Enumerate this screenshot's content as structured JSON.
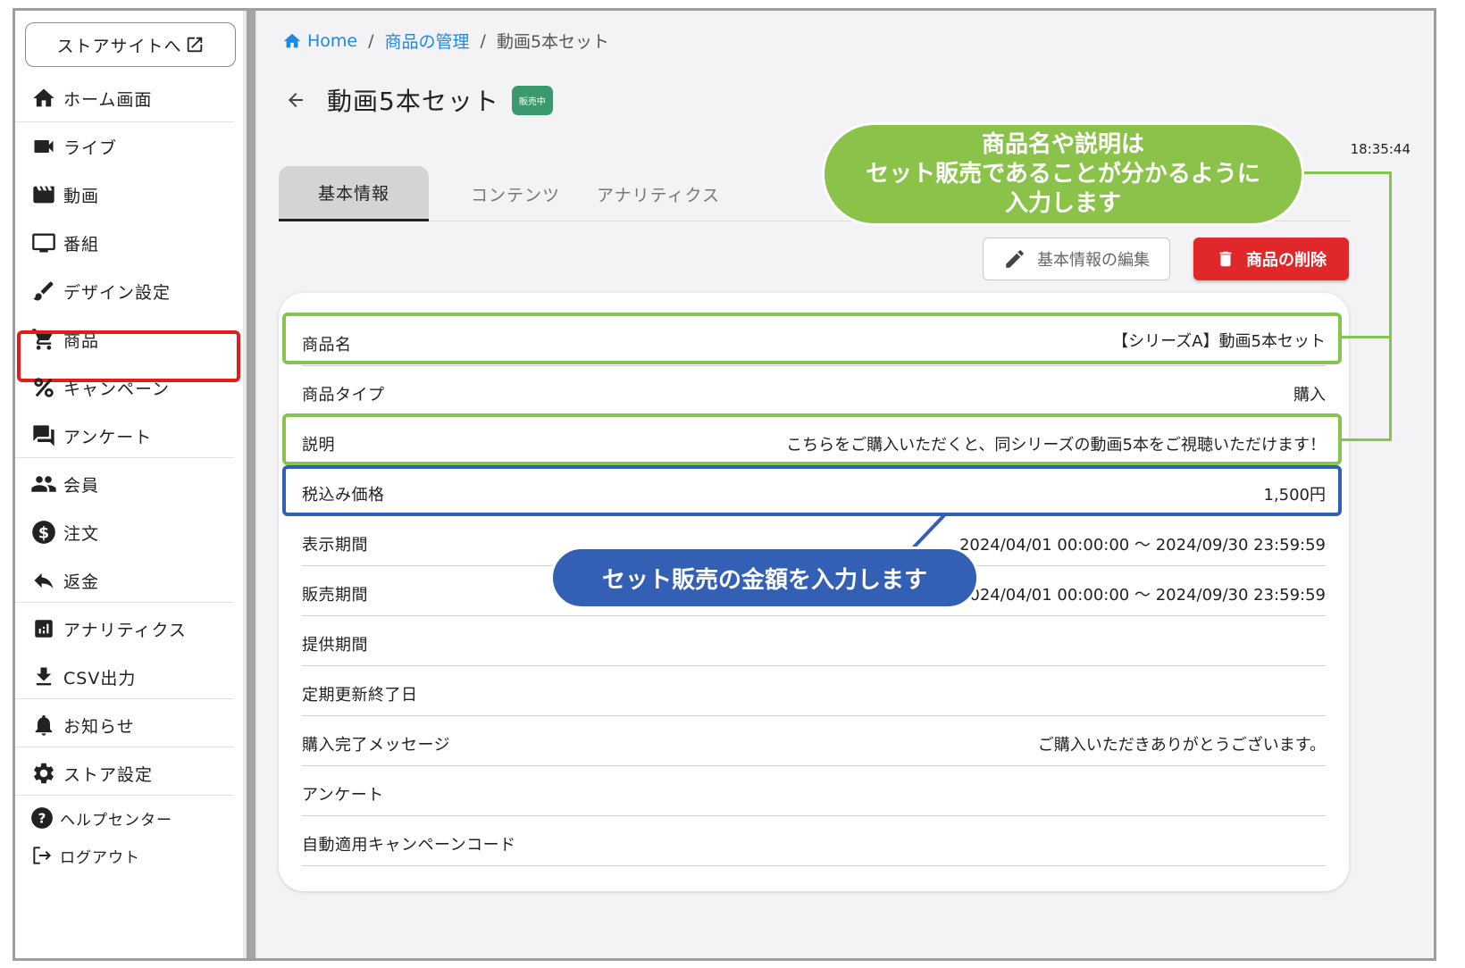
{
  "sidebar": {
    "store_link": "ストアサイトへ",
    "items": [
      {
        "label": "ホーム画面",
        "icon": "home-icon"
      },
      {
        "label": "ライブ",
        "icon": "videocam-icon"
      },
      {
        "label": "動画",
        "icon": "movie-icon"
      },
      {
        "label": "番組",
        "icon": "tv-icon"
      },
      {
        "label": "デザイン設定",
        "icon": "brush-icon"
      },
      {
        "label": "商品",
        "icon": "cart-icon"
      },
      {
        "label": "キャンペーン",
        "icon": "percent-icon"
      },
      {
        "label": "アンケート",
        "icon": "forum-icon"
      },
      {
        "label": "会員",
        "icon": "people-icon"
      },
      {
        "label": "注文",
        "icon": "dollar-icon"
      },
      {
        "label": "返金",
        "icon": "reply-icon"
      },
      {
        "label": "アナリティクス",
        "icon": "analytics-icon"
      },
      {
        "label": "CSV出力",
        "icon": "download-icon"
      },
      {
        "label": "お知らせ",
        "icon": "bell-icon"
      },
      {
        "label": "ストア設定",
        "icon": "gear-icon"
      }
    ],
    "help": "ヘルプセンター",
    "logout": "ログアウト"
  },
  "breadcrumb": {
    "home": "Home",
    "manage": "商品の管理",
    "current": "動画5本セット"
  },
  "title": "動画5本セット",
  "badge": "販売中",
  "time": "18:35:44",
  "tabs": [
    "基本情報",
    "コンテンツ",
    "アナリティクス"
  ],
  "actions": {
    "edit": "基本情報の編集",
    "delete": "商品の削除"
  },
  "details": [
    {
      "key": "商品名",
      "value": "【シリーズA】動画5本セット"
    },
    {
      "key": "商品タイプ",
      "value": "購入"
    },
    {
      "key": "説明",
      "value": "こちらをご購入いただくと、同シリーズの動画5本をご視聴いただけます！"
    },
    {
      "key": "税込み価格",
      "value": "1,500円"
    },
    {
      "key": "表示期間",
      "value": "2024/04/01 00:00:00 〜 2024/09/30 23:59:59"
    },
    {
      "key": "販売期間",
      "value": "2024/04/01 00:00:00 〜 2024/09/30 23:59:59"
    },
    {
      "key": "提供期間",
      "value": ""
    },
    {
      "key": "定期更新終了日",
      "value": ""
    },
    {
      "key": "購入完了メッセージ",
      "value": "ご購入いただきありがとうございます。"
    },
    {
      "key": "アンケート",
      "value": ""
    },
    {
      "key": "自動適用キャンペーンコード",
      "value": ""
    }
  ],
  "callouts": {
    "green": [
      "商品名や説明は",
      "セット販売であることが分かるように",
      "入力します"
    ],
    "blue": "セット販売の金額を入力します"
  },
  "colors": {
    "accent": "#1e88e5",
    "danger": "#e0282a",
    "status": "#3a9a6e",
    "callout_green": "#8bc34a",
    "callout_blue": "#3360b4",
    "selection": "#e41b1b"
  }
}
